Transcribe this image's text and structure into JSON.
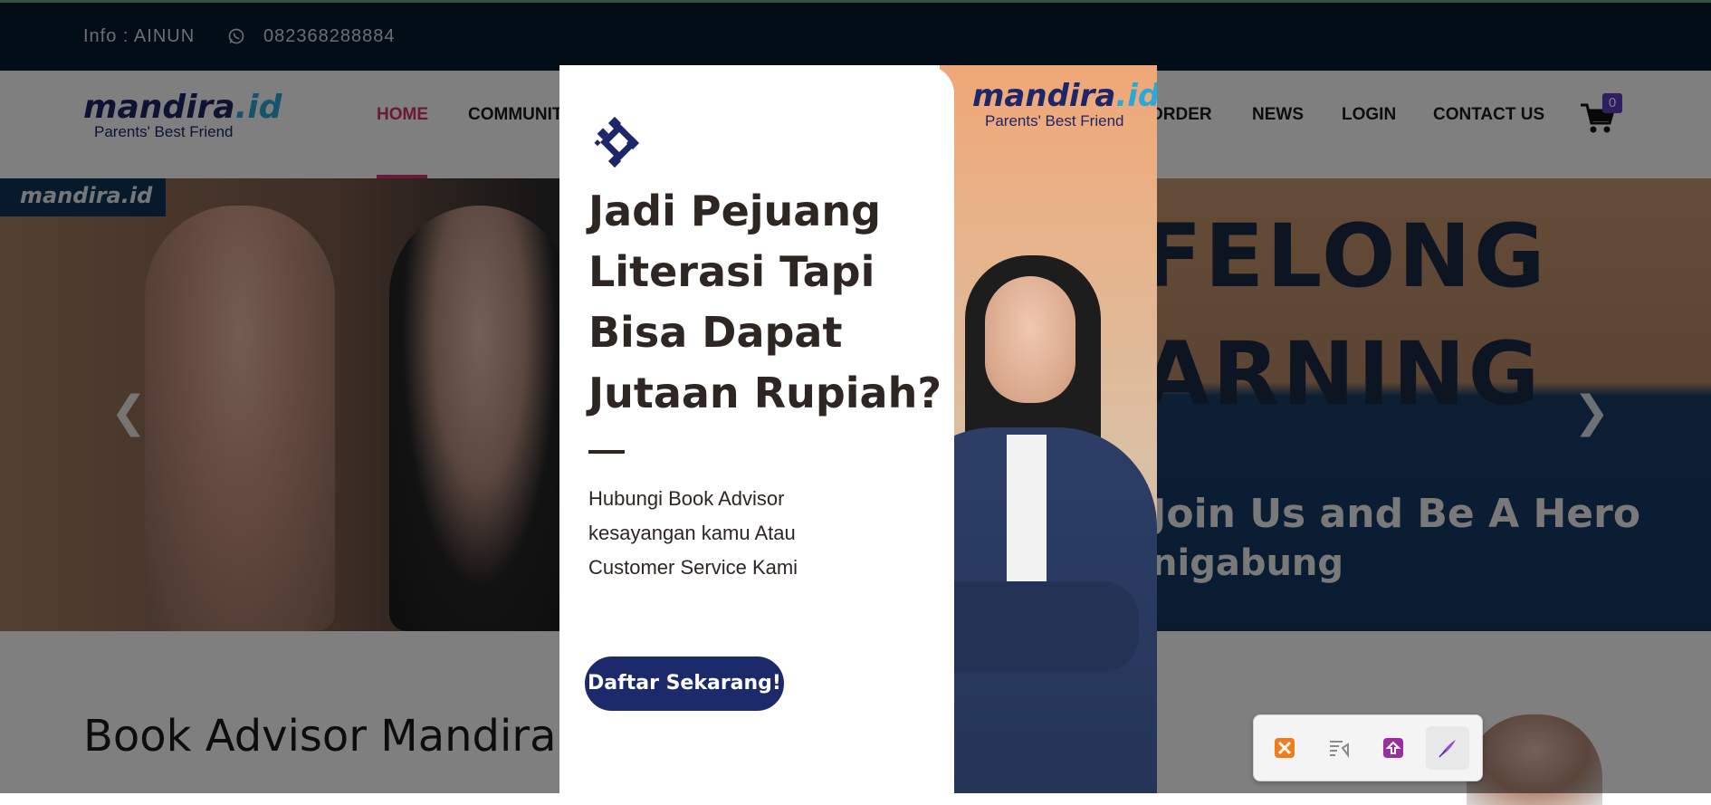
{
  "topbar": {
    "info": "Info : AINUN",
    "phone": "082368288884",
    "icon": "whatsapp-icon"
  },
  "logo": {
    "name_main": "mandira",
    "name_ext": ".id",
    "tagline": "Parents' Best Friend"
  },
  "nav": {
    "items": [
      {
        "label": "HOME",
        "active": true
      },
      {
        "label": "COMMUNIT",
        "active": false
      },
      {
        "label": "ORDER",
        "active": false
      },
      {
        "label": "NEWS",
        "active": false
      },
      {
        "label": "LOGIN",
        "active": false
      },
      {
        "label": "CONTACT US",
        "active": false
      }
    ],
    "cart_count": "0",
    "accent_color": "#d6336c"
  },
  "hero": {
    "badge": "mandira.id",
    "line1": "FELONG",
    "line2": "ARNING",
    "join": "Join Us and Be A Hero",
    "join_sub": "nigabung",
    "prev_arrow": "chevron-left-icon",
    "next_arrow": "chevron-right-icon"
  },
  "section": {
    "heading": "Book Advisor Mandira.ic"
  },
  "popup": {
    "logo_main": "mandira",
    "logo_ext": ".id",
    "logo_tagline": "Parents' Best Friend",
    "title": "Jadi Pejuang Literasi Tapi Bisa Dapat Jutaan Rupiah?",
    "desc": "Hubungi Book Advisor kesayangan kamu Atau Customer Service Kami",
    "cta": "Daftar Sekarang!",
    "cta_color": "#1c2a6b"
  },
  "taskbar": {
    "items": [
      {
        "icon": "xampp-icon",
        "color": "#f07c1b"
      },
      {
        "icon": "text-list-icon",
        "color": "#8a8a8a"
      },
      {
        "icon": "upload-app-icon",
        "color": "#9a2e9e"
      },
      {
        "icon": "feather-pen-icon",
        "color": "#8f4fd9"
      }
    ]
  }
}
